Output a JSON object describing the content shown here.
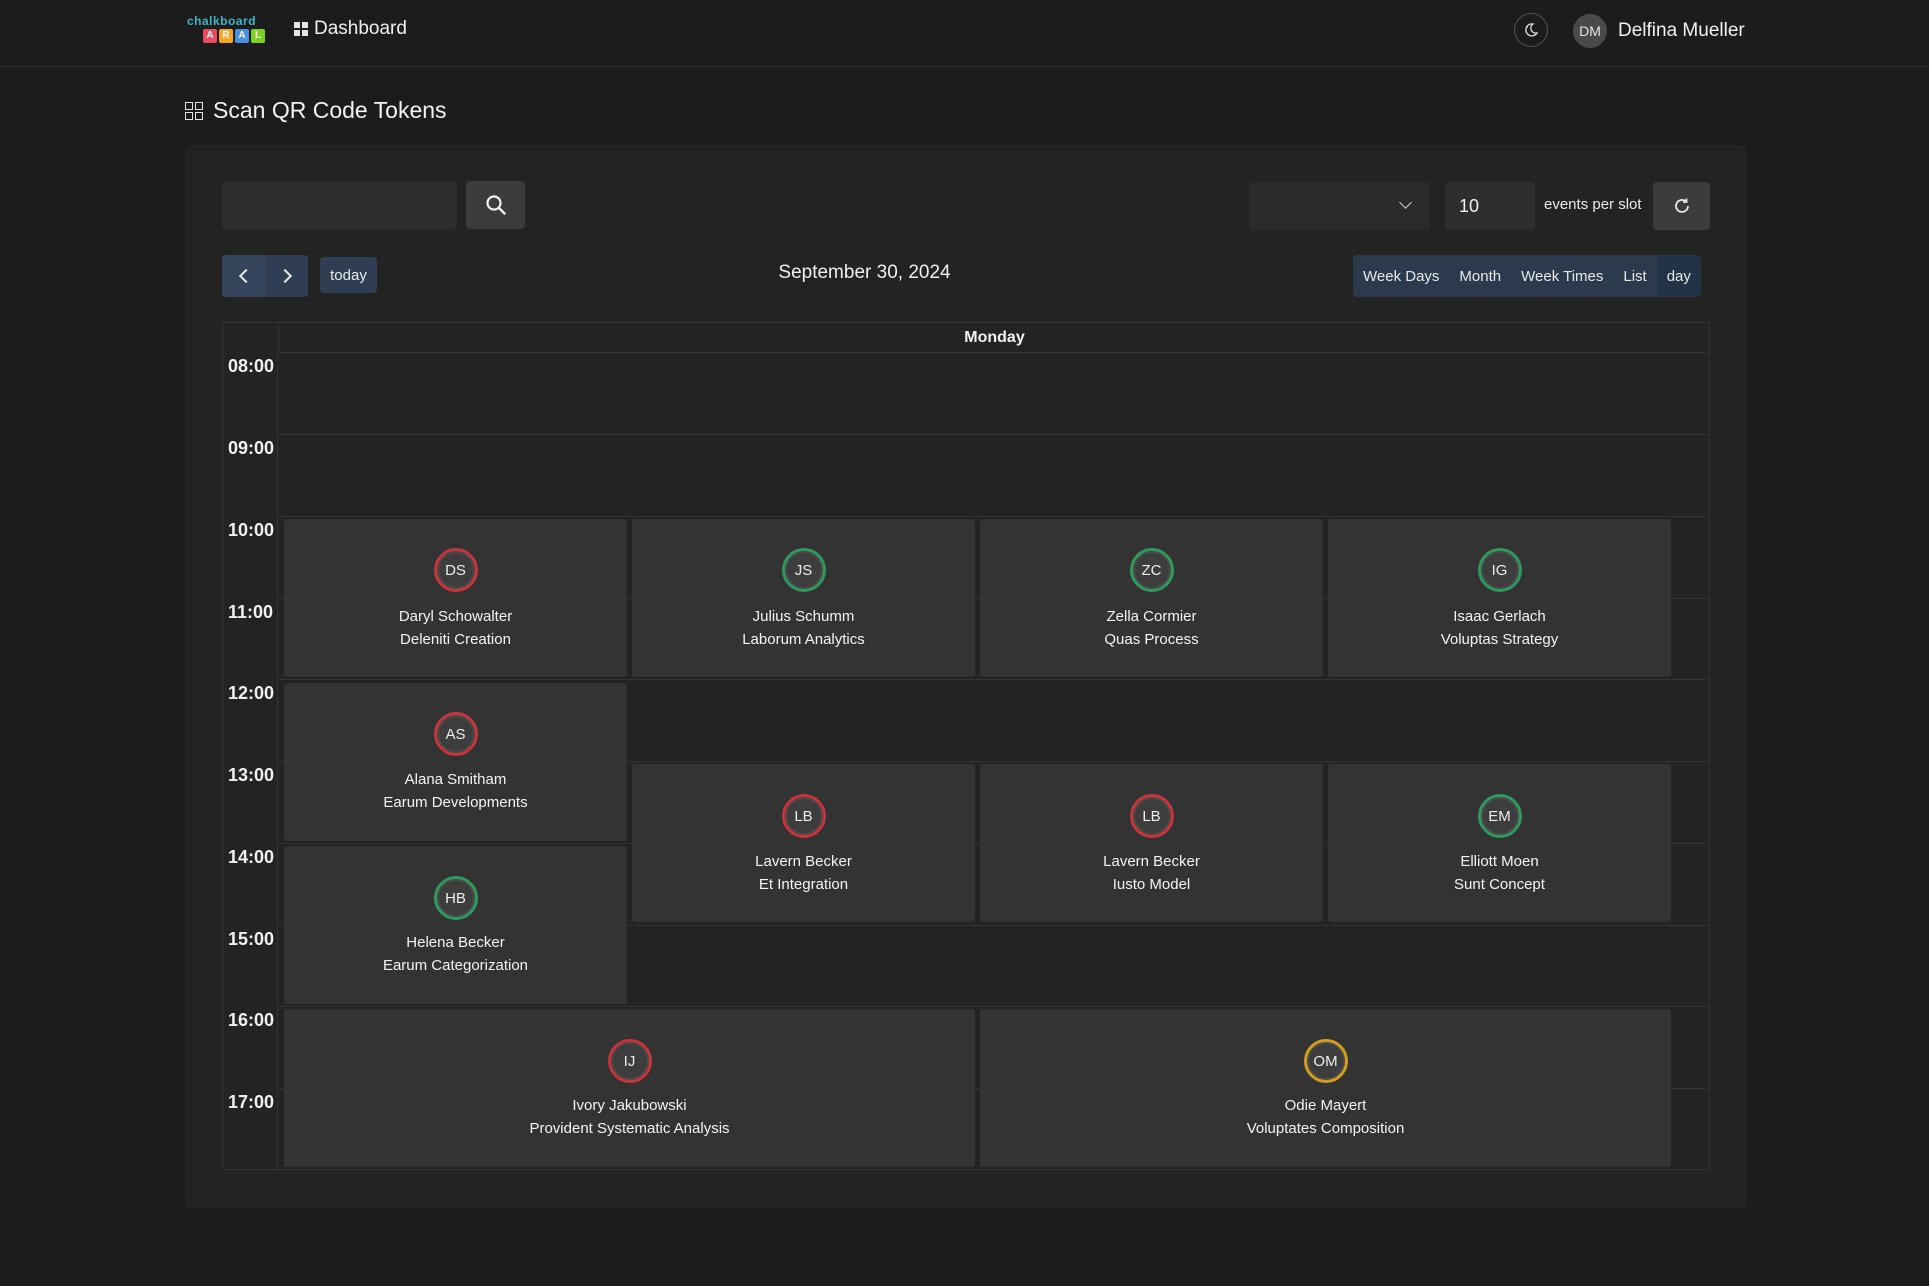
{
  "app": {
    "logo_text_top": "chalkboard",
    "logo_letters": [
      "A",
      "R",
      "A",
      "L"
    ],
    "logo_colors": [
      "#e84a5f",
      "#f5a623",
      "#4a90e2",
      "#7ed321"
    ],
    "nav_dashboard": "Dashboard",
    "user_initials": "DM",
    "user_name": "Delfina Mueller"
  },
  "page": {
    "title": "Scan QR Code Tokens"
  },
  "toolbar": {
    "search_value": "",
    "select_value": "",
    "events_per_slot_value": "10",
    "events_per_slot_label": "events per slot"
  },
  "calendar": {
    "today_label": "today",
    "date_title": "September 30, 2024",
    "views": [
      "Week Days",
      "Month",
      "Week Times",
      "List",
      "day"
    ],
    "active_view": "day",
    "day_header": "Monday",
    "hours": [
      "08:00",
      "09:00",
      "10:00",
      "11:00",
      "12:00",
      "13:00",
      "14:00",
      "15:00",
      "16:00",
      "17:00"
    ],
    "events": [
      {
        "initials": "DS",
        "name": "Daryl Schowalter",
        "company": "Deleniti Creation",
        "ring": "red"
      },
      {
        "initials": "JS",
        "name": "Julius Schumm",
        "company": "Laborum Analytics",
        "ring": "green"
      },
      {
        "initials": "ZC",
        "name": "Zella Cormier",
        "company": "Quas Process",
        "ring": "green"
      },
      {
        "initials": "IG",
        "name": "Isaac Gerlach",
        "company": "Voluptas Strategy",
        "ring": "green"
      },
      {
        "initials": "AS",
        "name": "Alana Smitham",
        "company": "Earum Developments",
        "ring": "red"
      },
      {
        "initials": "LB",
        "name": "Lavern Becker",
        "company": "Et Integration",
        "ring": "red"
      },
      {
        "initials": "LB",
        "name": "Lavern Becker",
        "company": "Iusto Model",
        "ring": "red"
      },
      {
        "initials": "EM",
        "name": "Elliott Moen",
        "company": "Sunt Concept",
        "ring": "green"
      },
      {
        "initials": "HB",
        "name": "Helena Becker",
        "company": "Earum Categorization",
        "ring": "green"
      },
      {
        "initials": "IJ",
        "name": "Ivory Jakubowski",
        "company": "Provident Systematic Analysis",
        "ring": "red"
      },
      {
        "initials": "OM",
        "name": "Odie Mayert",
        "company": "Voluptates Composition",
        "ring": "yellow"
      }
    ]
  },
  "colors": {
    "ring_red": "#c8343b",
    "ring_green": "#2f9a5c",
    "ring_yellow": "#d39e1d"
  }
}
